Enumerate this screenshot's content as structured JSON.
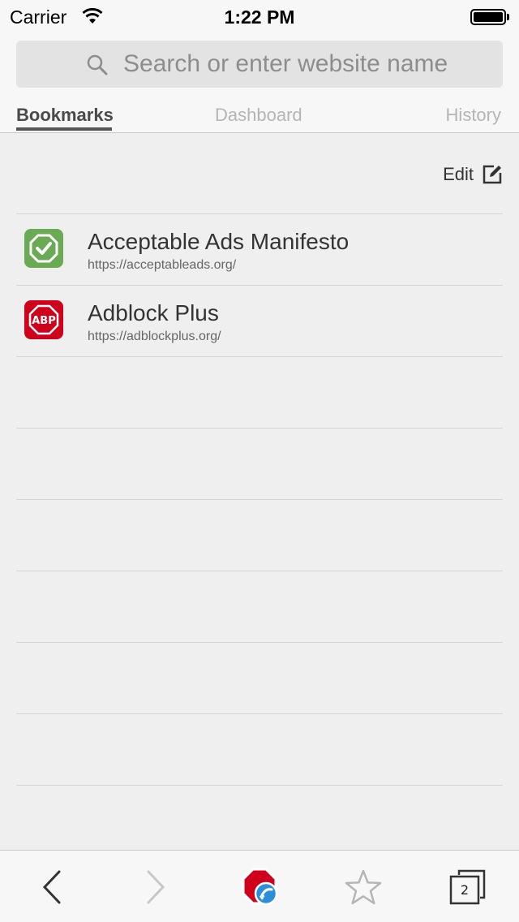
{
  "status_bar": {
    "carrier": "Carrier",
    "time": "1:22 PM"
  },
  "search": {
    "placeholder": "Search or enter website name"
  },
  "tabs": [
    {
      "label": "Bookmarks",
      "active": true
    },
    {
      "label": "Dashboard",
      "active": false
    },
    {
      "label": "History",
      "active": false
    }
  ],
  "edit": {
    "label": "Edit",
    "icon": "edit-icon"
  },
  "bookmarks": [
    {
      "title": "Acceptable Ads Manifesto",
      "url": "https://acceptableads.org/",
      "icon": "acceptable-ads-icon",
      "color": "#6aaa55"
    },
    {
      "title": "Adblock Plus",
      "url": "https://adblockplus.org/",
      "icon": "abp-icon",
      "color": "#d0021b"
    }
  ],
  "toolbar": {
    "tab_count": "2",
    "colors": {
      "accent_red": "#d0021b",
      "accent_blue": "#2a8fd8"
    }
  }
}
